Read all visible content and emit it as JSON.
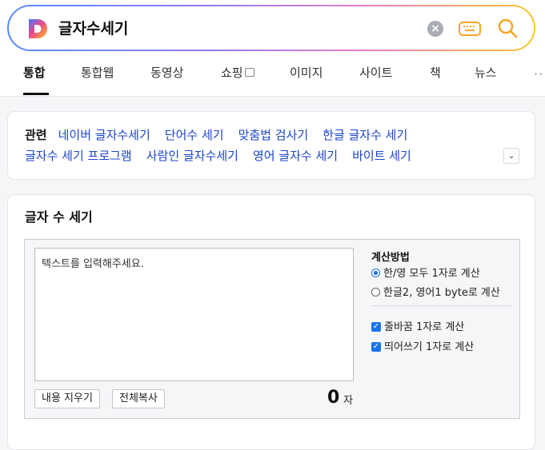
{
  "search": {
    "query": "글자수세기"
  },
  "tabs": [
    {
      "label": "통합"
    },
    {
      "label": "통합웹"
    },
    {
      "label": "동영상"
    },
    {
      "label": "쇼핑"
    },
    {
      "label": "이미지"
    },
    {
      "label": "사이트"
    },
    {
      "label": "책"
    },
    {
      "label": "뉴스"
    }
  ],
  "related": {
    "label": "관련",
    "links": [
      "네이버 글자수세기",
      "단어수 세기",
      "맞춤법 검사기",
      "한글 글자수 세기",
      "글자수 세기 프로그램",
      "사람인 글자수세기",
      "영어 글자수 세기",
      "바이트 세기"
    ]
  },
  "counter": {
    "title": "글자 수 세기",
    "placeholder": "텍스트를 입력해주세요.",
    "clear_label": "내용 지우기",
    "copy_label": "전체복사",
    "count": "0",
    "unit": "자",
    "options_title": "계산방법",
    "radio_options": [
      {
        "label": "한/영 모두 1자로 계산",
        "selected": true
      },
      {
        "label": "한글2, 영어1 byte로 계산",
        "selected": false
      }
    ],
    "checkbox_options": [
      {
        "label": "줄바꿈 1자로 계산",
        "checked": true
      },
      {
        "label": "띄어쓰기 1자로 계산",
        "checked": true
      }
    ]
  },
  "colors": {
    "link": "#1c46c7",
    "accent": "#1a73e8",
    "keyboard_icon": "#f5a623",
    "search_icon": "#f5a623"
  },
  "icons": [
    "daum-logo-icon",
    "clear-icon",
    "keyboard-icon",
    "search-icon",
    "external-link-icon",
    "chevron-down-icon",
    "more-icon"
  ]
}
